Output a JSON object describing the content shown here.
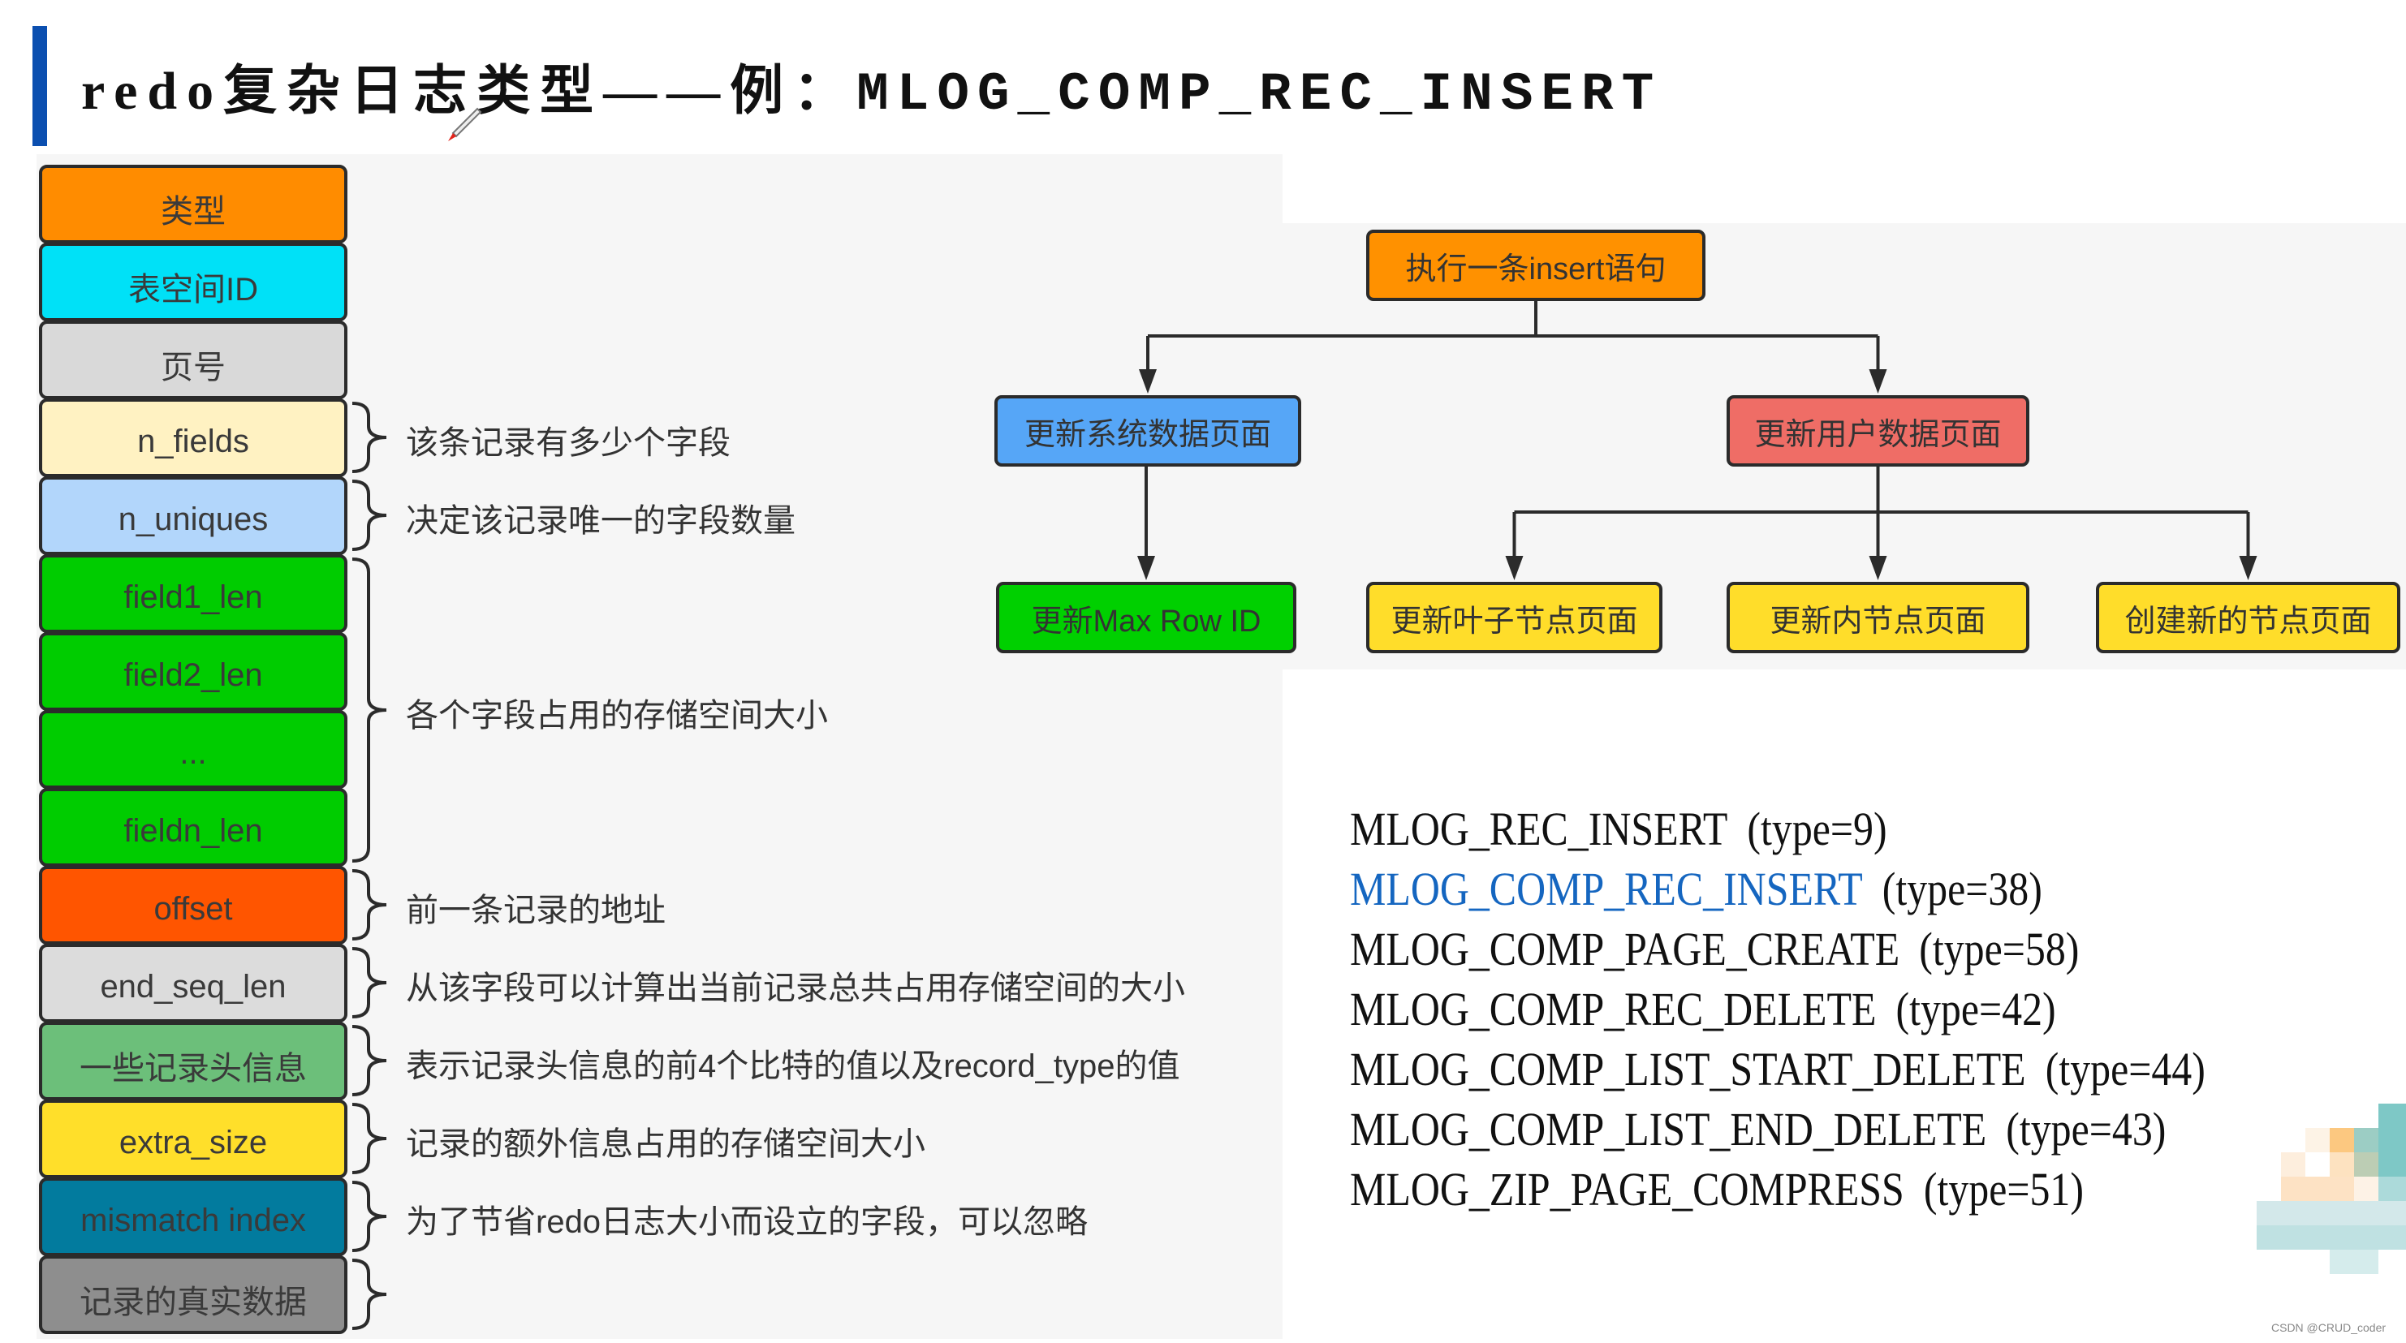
{
  "header": {
    "title_cn": "redo复杂日志类型——例：",
    "title_code": "MLOG_COMP_REC_INSERT",
    "accent_color": "#0b4fb0"
  },
  "record_format": {
    "fields": [
      {
        "label": "类型",
        "color": "#ff8c00"
      },
      {
        "label": "表空间ID",
        "color": "#00e1f7"
      },
      {
        "label": "页号",
        "color": "#d9d9d9"
      },
      {
        "label": "n_fields",
        "color": "#fff2c2"
      },
      {
        "label": "n_uniques",
        "color": "#b2d6fb"
      },
      {
        "label": "field1_len",
        "color": "#00cc00"
      },
      {
        "label": "field2_len",
        "color": "#00cc00"
      },
      {
        "label": "...",
        "color": "#00cc00"
      },
      {
        "label": "fieldn_len",
        "color": "#00cc00"
      },
      {
        "label": "offset",
        "color": "#ff5500"
      },
      {
        "label": "end_seq_len",
        "color": "#dcdcdc"
      },
      {
        "label": "一些记录头信息",
        "color": "#6cbf7a"
      },
      {
        "label": "extra_size",
        "color": "#ffdf2a"
      },
      {
        "label": "mismatch index",
        "color": "#027b9e"
      },
      {
        "label": "记录的真实数据",
        "color": "#8e8e8e"
      }
    ],
    "annotations": [
      {
        "text": "该条记录有多少个字段",
        "from_field": 3,
        "to_field": 3
      },
      {
        "text": "决定该记录唯一的字段数量",
        "from_field": 4,
        "to_field": 4
      },
      {
        "text": "各个字段占用的存储空间大小",
        "from_field": 5,
        "to_field": 8
      },
      {
        "text": "前一条记录的地址",
        "from_field": 9,
        "to_field": 9
      },
      {
        "text": "从该字段可以计算出当前记录总共占用存储空间的大小",
        "from_field": 10,
        "to_field": 10
      },
      {
        "text": "表示记录头信息的前4个比特的值以及record_type的值",
        "from_field": 11,
        "to_field": 11
      },
      {
        "text": "记录的额外信息占用的存储空间大小",
        "from_field": 12,
        "to_field": 12
      },
      {
        "text": "为了节省redo日志大小而设立的字段，可以忽略",
        "from_field": 13,
        "to_field": 13
      },
      {
        "text": "",
        "from_field": 14,
        "to_field": 14
      }
    ]
  },
  "flow": {
    "nodes": [
      {
        "id": "root",
        "label": "执行一条insert语句",
        "color": "#ff9100"
      },
      {
        "id": "sys",
        "label": "更新系统数据页面",
        "color": "#56a6f7"
      },
      {
        "id": "user",
        "label": "更新用户数据页面",
        "color": "#ef6d66"
      },
      {
        "id": "maxrow",
        "label": "更新Max Row ID",
        "color": "#00d000"
      },
      {
        "id": "leaf",
        "label": "更新叶子节点页面",
        "color": "#ffdd2a"
      },
      {
        "id": "inner",
        "label": "更新内节点页面",
        "color": "#ffdd2a"
      },
      {
        "id": "newnode",
        "label": "创建新的节点页面",
        "color": "#ffdd2a"
      }
    ],
    "edges": [
      [
        "root",
        "sys"
      ],
      [
        "root",
        "user"
      ],
      [
        "sys",
        "maxrow"
      ],
      [
        "user",
        "leaf"
      ],
      [
        "user",
        "inner"
      ],
      [
        "user",
        "newnode"
      ]
    ]
  },
  "type_list": [
    {
      "name": "MLOG_REC_INSERT",
      "value": "(type=9)",
      "highlight": false
    },
    {
      "name": "MLOG_COMP_REC_INSERT",
      "value": "(type=38)",
      "highlight": true
    },
    {
      "name": "MLOG_COMP_PAGE_CREATE",
      "value": "(type=58)",
      "highlight": false
    },
    {
      "name": "MLOG_COMP_REC_DELETE",
      "value": "(type=42)",
      "highlight": false
    },
    {
      "name": "MLOG_COMP_LIST_START_DELETE",
      "value": "(type=44)",
      "highlight": false
    },
    {
      "name": "MLOG_COMP_LIST_END_DELETE",
      "value": "(type=43)",
      "highlight": false
    },
    {
      "name": "MLOG_ZIP_PAGE_COMPRESS",
      "value": "(type=51)",
      "highlight": false
    }
  ],
  "watermark": "CSDN @CRUD_coder"
}
